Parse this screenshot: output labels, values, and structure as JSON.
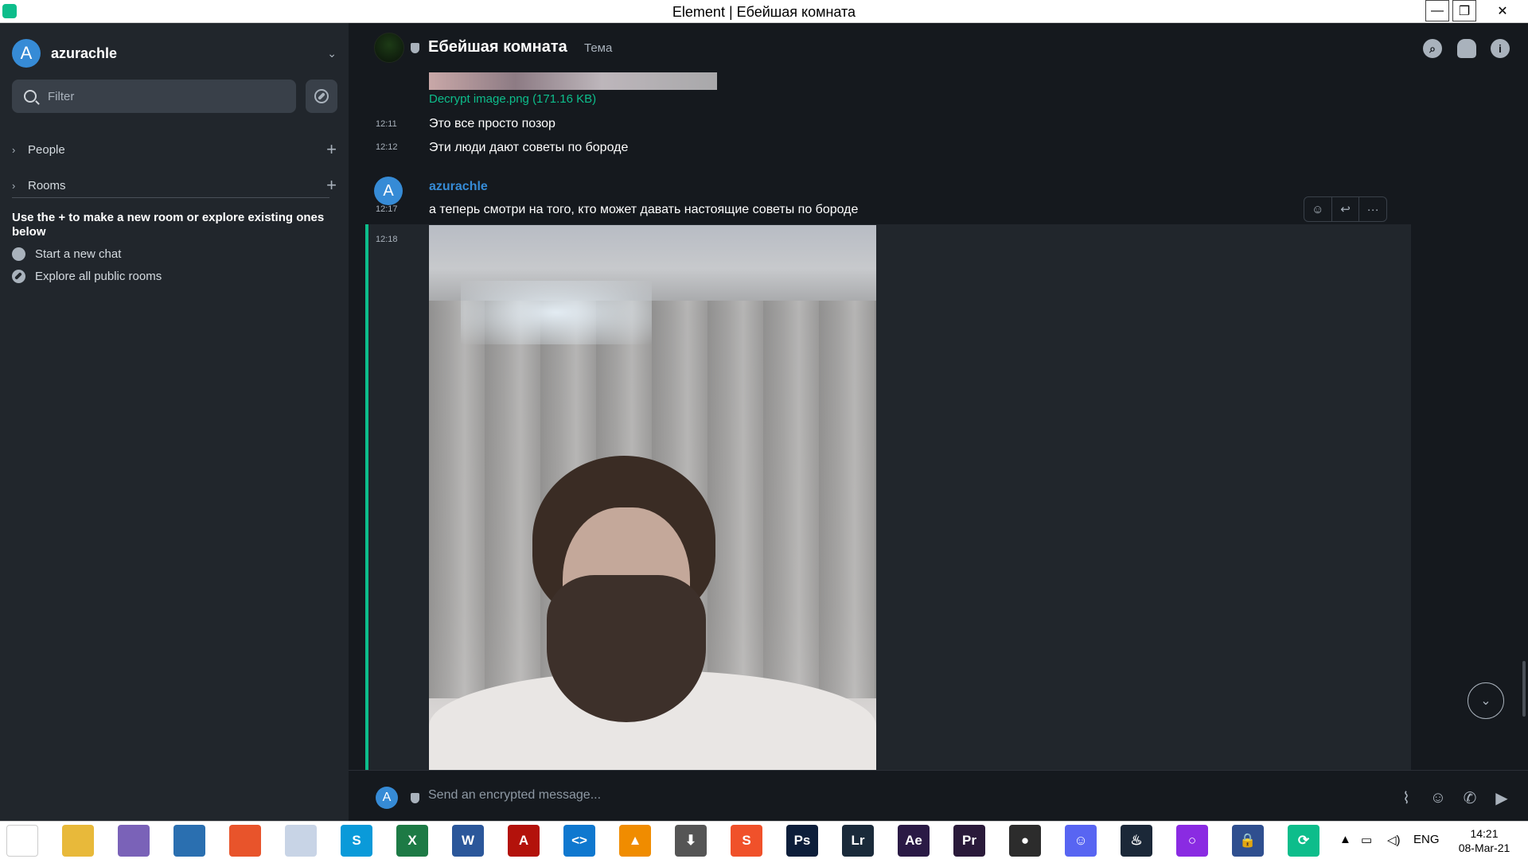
{
  "window": {
    "title": "Element | Ебейшая комната",
    "min": "—",
    "max": "❐",
    "close": "✕"
  },
  "sidebar": {
    "user": {
      "initial": "A",
      "name": "azurachle"
    },
    "filter_placeholder": "Filter",
    "sections": [
      {
        "label": "People"
      },
      {
        "label": "Rooms"
      }
    ],
    "hint": "Use the + to make a new room or explore existing ones below",
    "links": [
      {
        "label": "Start a new chat",
        "icon": "chat-bubble-icon"
      },
      {
        "label": "Explore all public rooms",
        "icon": "compass-icon"
      }
    ]
  },
  "room": {
    "name": "Ебейшая комната",
    "topic": "Тема"
  },
  "timeline": {
    "file_link": "Decrypt image.png (171.16 KB)",
    "messages": [
      {
        "time": "12:11",
        "text": "Это все просто позор"
      },
      {
        "time": "12:12",
        "text": "Эти люди дают советы по бороде"
      },
      {
        "time": "12:17",
        "sender": "azurachle",
        "sender_initial": "A",
        "text": "а теперь смотри на того, кто может давать настоящие советы по бороде"
      },
      {
        "time": "12:18",
        "type": "image"
      }
    ]
  },
  "composer": {
    "placeholder": "Send an encrypted message...",
    "initial": "A"
  },
  "taskbar": {
    "apps": [
      {
        "name": "start",
        "label": "",
        "color": "#ffffff"
      },
      {
        "name": "file-explorer",
        "label": "",
        "color": "#e8b93a"
      },
      {
        "name": "bittorrent",
        "label": "",
        "color": "#7a62b8"
      },
      {
        "name": "browser-globe",
        "label": "",
        "color": "#2a6fb0"
      },
      {
        "name": "firefox",
        "label": "",
        "color": "#e8542b"
      },
      {
        "name": "orb",
        "label": "",
        "color": "#c8d4e6"
      },
      {
        "name": "skype",
        "label": "S",
        "color": "#0a9ad9"
      },
      {
        "name": "excel",
        "label": "X",
        "color": "#1d7a45"
      },
      {
        "name": "word",
        "label": "W",
        "color": "#2b579a"
      },
      {
        "name": "acrobat",
        "label": "A",
        "color": "#b3120b"
      },
      {
        "name": "vscode",
        "label": "<>",
        "color": "#0f78cf"
      },
      {
        "name": "vlc",
        "label": "▲",
        "color": "#f08c00"
      },
      {
        "name": "downloader",
        "label": "⬇",
        "color": "#555555"
      },
      {
        "name": "smartgit",
        "label": "S",
        "color": "#f0512a"
      },
      {
        "name": "photoshop",
        "label": "Ps",
        "color": "#0d1e3a"
      },
      {
        "name": "lightroom",
        "label": "Lr",
        "color": "#1a2a3a"
      },
      {
        "name": "after-effects",
        "label": "Ae",
        "color": "#2a1a45"
      },
      {
        "name": "premiere",
        "label": "Pr",
        "color": "#2a1a3a"
      },
      {
        "name": "obs",
        "label": "●",
        "color": "#2c2c2c"
      },
      {
        "name": "discord",
        "label": "☺",
        "color": "#5865f2"
      },
      {
        "name": "steam",
        "label": "♨",
        "color": "#1b2838"
      },
      {
        "name": "cortana",
        "label": "○",
        "color": "#8a2be2"
      },
      {
        "name": "keepass",
        "label": "🔒",
        "color": "#2f4f8f"
      },
      {
        "name": "element",
        "label": "⟳",
        "color": "#0dbd8b"
      }
    ],
    "lang": "ENG",
    "time": "14:21",
    "date": "08-Mar-21"
  }
}
